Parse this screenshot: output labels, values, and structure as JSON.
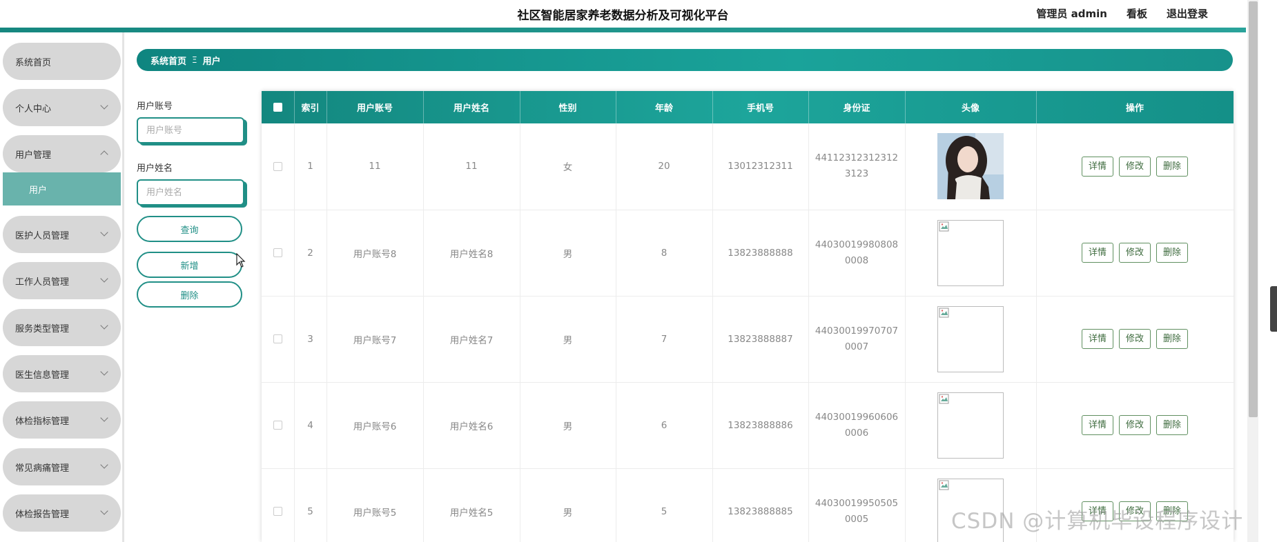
{
  "header": {
    "title": "社区智能居家养老数据分析及可视化平台",
    "user_label": "管理员 admin",
    "board_label": "看板",
    "logout_label": "退出登录"
  },
  "sidebar": {
    "items": [
      {
        "label": "系统首页",
        "has_arrow": false
      },
      {
        "label": "个人中心",
        "has_arrow": true
      },
      {
        "label": "用户管理",
        "has_arrow": true,
        "expanded": true
      },
      {
        "label": "医护人员管理",
        "has_arrow": true
      },
      {
        "label": "工作人员管理",
        "has_arrow": true
      },
      {
        "label": "服务类型管理",
        "has_arrow": true
      },
      {
        "label": "医生信息管理",
        "has_arrow": true
      },
      {
        "label": "体检指标管理",
        "has_arrow": true
      },
      {
        "label": "常见病痛管理",
        "has_arrow": true
      },
      {
        "label": "体检报告管理",
        "has_arrow": true
      }
    ],
    "submenu": {
      "label": "用户"
    }
  },
  "breadcrumb": {
    "home": "系统首页",
    "separator": "Ξ",
    "current": "用户"
  },
  "search": {
    "account_label": "用户账号",
    "account_placeholder": "用户账号",
    "name_label": "用户姓名",
    "name_placeholder": "用户姓名",
    "query_button": "查询",
    "add_button": "新增",
    "delete_button": "删除"
  },
  "table": {
    "columns": [
      "",
      "索引",
      "用户账号",
      "用户姓名",
      "性别",
      "年龄",
      "手机号",
      "身份证",
      "头像",
      "操作"
    ],
    "actions": {
      "detail": "详情",
      "edit": "修改",
      "delete": "删除"
    },
    "rows": [
      {
        "index": "1",
        "account": "11",
        "name": "11",
        "gender": "女",
        "age": "20",
        "phone": "13012312311",
        "idcard": "441123123123123123",
        "avatar": "photo"
      },
      {
        "index": "2",
        "account": "用户账号8",
        "name": "用户姓名8",
        "gender": "男",
        "age": "8",
        "phone": "13823888888",
        "idcard": "440300199808080008",
        "avatar": "broken"
      },
      {
        "index": "3",
        "account": "用户账号7",
        "name": "用户姓名7",
        "gender": "男",
        "age": "7",
        "phone": "13823888887",
        "idcard": "440300199707070007",
        "avatar": "broken"
      },
      {
        "index": "4",
        "account": "用户账号6",
        "name": "用户姓名6",
        "gender": "男",
        "age": "6",
        "phone": "13823888886",
        "idcard": "440300199606060006",
        "avatar": "broken"
      },
      {
        "index": "5",
        "account": "用户账号5",
        "name": "用户姓名5",
        "gender": "男",
        "age": "5",
        "phone": "13823888885",
        "idcard": "440300199505050005",
        "avatar": "broken"
      }
    ]
  },
  "watermark": "CSDN @计算机毕设程序设计",
  "colors": {
    "accent": "#16877f",
    "menu_bg": "#d7d7d7",
    "submenu_bg": "#69b3ac"
  }
}
